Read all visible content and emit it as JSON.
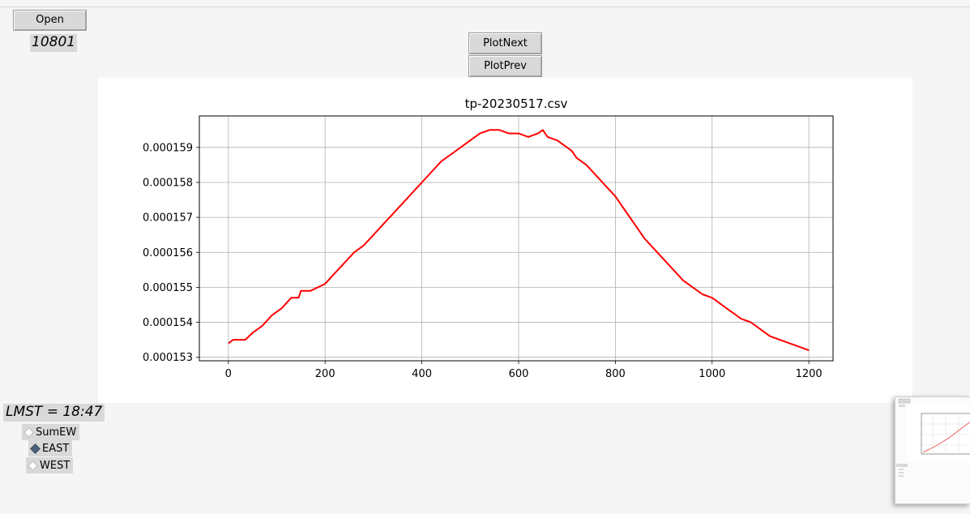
{
  "controls": {
    "open_label": "Open",
    "count_value": "10801",
    "plot_next_label": "PlotNext",
    "plot_prev_label": "PlotPrev",
    "lmst_text": "LMST = 18:47"
  },
  "channels": [
    {
      "label": "SumEW",
      "selected": false
    },
    {
      "label": "EAST",
      "selected": true
    },
    {
      "label": "WEST",
      "selected": false
    }
  ],
  "chart_data": {
    "type": "line",
    "title": "tp-20230517.csv",
    "xlabel": "",
    "ylabel": "",
    "grid": true,
    "line_color": "#ff0000",
    "xlim": [
      -60,
      1250
    ],
    "ylim": [
      0.0001529,
      0.0001599
    ],
    "xticks": [
      0,
      200,
      400,
      600,
      800,
      1000,
      1200
    ],
    "yticks": [
      0.000153,
      0.000154,
      0.000155,
      0.000156,
      0.000157,
      0.000158,
      0.000159
    ],
    "ytick_labels": [
      "0.000153",
      "0.000154",
      "0.000155",
      "0.000156",
      "0.000157",
      "0.000158",
      "0.000159"
    ],
    "series": [
      {
        "x": [
          0,
          10,
          20,
          35,
          50,
          70,
          90,
          110,
          130,
          145,
          150,
          160,
          170,
          185,
          200,
          220,
          240,
          260,
          280,
          300,
          320,
          340,
          360,
          380,
          400,
          420,
          440,
          460,
          480,
          500,
          520,
          540,
          560,
          580,
          600,
          620,
          640,
          650,
          660,
          680,
          700,
          710,
          720,
          740,
          760,
          780,
          800,
          820,
          840,
          860,
          880,
          900,
          920,
          940,
          960,
          980,
          1000,
          1020,
          1040,
          1060,
          1080,
          1100,
          1120,
          1140,
          1160,
          1180,
          1200
        ],
        "y": [
          0.0001534,
          0.0001535,
          0.0001535,
          0.0001535,
          0.0001537,
          0.0001539,
          0.0001542,
          0.0001544,
          0.0001547,
          0.0001547,
          0.0001549,
          0.0001549,
          0.0001549,
          0.000155,
          0.0001551,
          0.0001554,
          0.0001557,
          0.000156,
          0.0001562,
          0.0001565,
          0.0001568,
          0.0001571,
          0.0001574,
          0.0001577,
          0.000158,
          0.0001583,
          0.0001586,
          0.0001588,
          0.000159,
          0.0001592,
          0.0001594,
          0.0001595,
          0.0001595,
          0.0001594,
          0.0001594,
          0.0001593,
          0.0001594,
          0.0001595,
          0.0001593,
          0.0001592,
          0.000159,
          0.0001589,
          0.0001587,
          0.0001585,
          0.0001582,
          0.0001579,
          0.0001576,
          0.0001572,
          0.0001568,
          0.0001564,
          0.0001561,
          0.0001558,
          0.0001555,
          0.0001552,
          0.000155,
          0.0001548,
          0.0001547,
          0.0001545,
          0.0001543,
          0.0001541,
          0.000154,
          0.0001538,
          0.0001536,
          0.0001535,
          0.0001534,
          0.0001533,
          0.0001532
        ]
      }
    ]
  }
}
